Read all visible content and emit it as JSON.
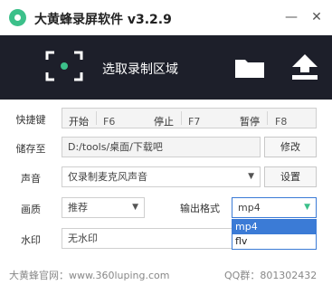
{
  "window": {
    "title": "大黄蜂录屏软件 v3.2.9",
    "minimize_glyph": "—",
    "close_glyph": "✕"
  },
  "toolbar": {
    "record_region_label": "选取录制区域",
    "folder_icon": "folder-icon",
    "upload_icon": "upload-icon"
  },
  "hotkeys": {
    "label": "快捷键",
    "start_label": "开始",
    "start_key": "F6",
    "stop_label": "停止",
    "stop_key": "F7",
    "pause_label": "暂停",
    "pause_key": "F8"
  },
  "save": {
    "label": "储存至",
    "path": "D:/tools/桌面/下载吧",
    "modify_button": "修改"
  },
  "audio": {
    "label": "声音",
    "selected": "仅录制麦克风声音",
    "settings_button": "设置"
  },
  "quality": {
    "label": "画质",
    "selected": "推荐"
  },
  "format": {
    "label": "输出格式",
    "selected": "mp4",
    "options": [
      "mp4",
      "flv"
    ]
  },
  "watermark": {
    "label": "水印",
    "selected": "无水印"
  },
  "footer": {
    "website": "大黄蜂官网：www.360luping.com",
    "qq": "QQ群：801302432"
  },
  "colors": {
    "accent": "#3cc08a",
    "toolbar_bg": "#1d1f2a",
    "dropdown_highlight": "#3b7bd6"
  }
}
